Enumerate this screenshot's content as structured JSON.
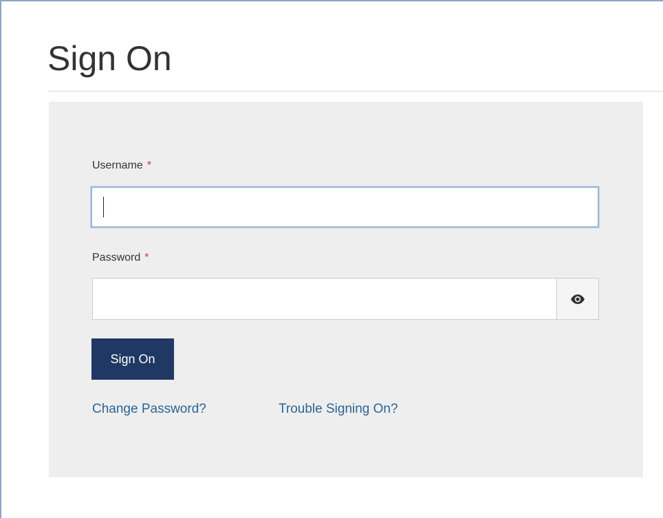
{
  "page": {
    "title": "Sign On"
  },
  "form": {
    "username_label": "Username",
    "password_label": "Password",
    "required_marker": "*",
    "username_value": "",
    "password_value": "",
    "show_password_icon": "eye-icon",
    "submit_label": "Sign On"
  },
  "links": {
    "change_password": "Change Password?",
    "trouble_signing_on": "Trouble Signing On?"
  },
  "colors": {
    "button_bg": "#1f3864",
    "link": "#2a6496",
    "required": "#d32f2f",
    "panel_bg": "#eeeeee"
  }
}
